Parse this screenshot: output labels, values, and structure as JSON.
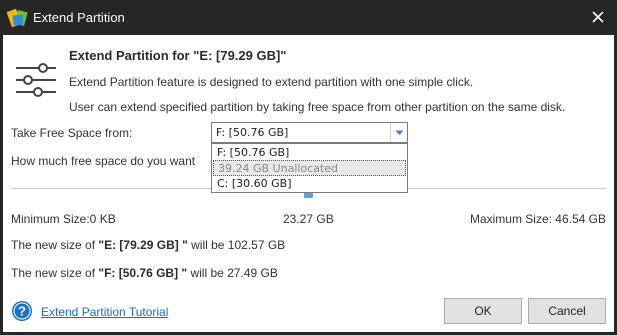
{
  "window": {
    "title": "Extend Partition",
    "app_icon": "partition-wizard-icon",
    "close_icon": "close-icon"
  },
  "header": {
    "icon": "sliders-icon",
    "heading": "Extend Partition for \"E: [79.29 GB]\"",
    "description_1": "Extend Partition feature is designed to extend partition with one simple click.",
    "description_2": "User can extend specified partition by taking free space from other partition on the same disk."
  },
  "take_free_space": {
    "label": "Take Free Space from:",
    "selected": "F:  [50.76 GB]",
    "options": [
      "F:  [50.76 GB]",
      "39.24 GB Unallocated",
      "C:  [30.60 GB]"
    ],
    "highlighted_index": 1
  },
  "how_much": {
    "label": "How much free space do you want"
  },
  "sizes": {
    "minimum": "Minimum Size:0 KB",
    "current": "23.27 GB",
    "maximum": "Maximum Size: 46.54 GB",
    "slider_fraction": 0.5
  },
  "new_sizes": {
    "e_prefix": "The new size of ",
    "e_name": "\"E: [79.29 GB] \"",
    "e_suffix": " will be 102.57 GB",
    "f_prefix": "The new size of ",
    "f_name": "\"F: [50.76 GB] \"",
    "f_suffix": " will be 27.49 GB"
  },
  "footer": {
    "help_icon": "help-icon",
    "tutorial_link": "Extend Partition Tutorial",
    "ok_label": "OK",
    "cancel_label": "Cancel"
  },
  "colors": {
    "titlebar": "#262626",
    "accent": "#1a6fc4",
    "slider": "#5aa3e0"
  }
}
